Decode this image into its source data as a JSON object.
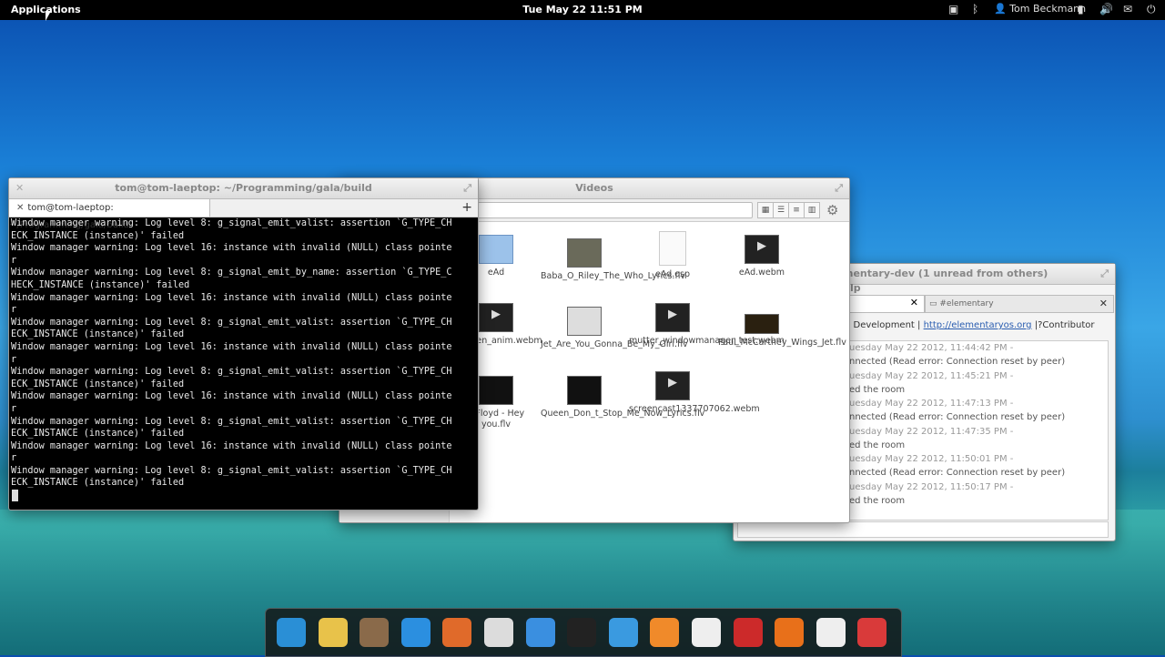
{
  "panel": {
    "applications": "Applications",
    "clock": "Tue May 22 11:51 PM",
    "user": "Tom Beckmann"
  },
  "terminal": {
    "title": "tom@tom-laeptop: ~/Programming/gala/build",
    "tab_label": "tom@tom-laeptop: ~/Programming/gala/build",
    "output": "Window manager warning: Log level 8: g_signal_emit_valist: assertion `G_TYPE_CH\nECK_INSTANCE (instance)' failed\nWindow manager warning: Log level 16: instance with invalid (NULL) class pointe\nr\nWindow manager warning: Log level 8: g_signal_emit_by_name: assertion `G_TYPE_C\nHECK_INSTANCE (instance)' failed\nWindow manager warning: Log level 16: instance with invalid (NULL) class pointe\nr\nWindow manager warning: Log level 8: g_signal_emit_valist: assertion `G_TYPE_CH\nECK_INSTANCE (instance)' failed\nWindow manager warning: Log level 16: instance with invalid (NULL) class pointe\nr\nWindow manager warning: Log level 8: g_signal_emit_valist: assertion `G_TYPE_CH\nECK_INSTANCE (instance)' failed\nWindow manager warning: Log level 16: instance with invalid (NULL) class pointe\nr\nWindow manager warning: Log level 8: g_signal_emit_valist: assertion `G_TYPE_CH\nECK_INSTANCE (instance)' failed\nWindow manager warning: Log level 16: instance with invalid (NULL) class pointe\nr\nWindow manager warning: Log level 8: g_signal_emit_valist: assertion `G_TYPE_CH\nECK_INSTANCE (instance)' failed"
  },
  "files": {
    "title": "Videos",
    "items": [
      {
        "name": "eAd",
        "kind": "folder"
      },
      {
        "name": "Baba_O_Riley_The_Who_Lyrics.flv",
        "kind": "video-frame"
      },
      {
        "name": "eAd.osp",
        "kind": "document"
      },
      {
        "name": "eAd.webm",
        "kind": "video"
      },
      {
        "name": "er_open_anim.webm",
        "kind": "video"
      },
      {
        "name": "Jet_Are_You_Gonna_Be_My_Girl.flv",
        "kind": "video-frame"
      },
      {
        "name": "mutter_windowmanager_test.webm",
        "kind": "video"
      },
      {
        "name": "Paul_McCartney_Wings_Jet.flv",
        "kind": "video-frame"
      },
      {
        "name": "k Floyd - Hey you.flv",
        "kind": "video-frame"
      },
      {
        "name": "Queen_Don_t_Stop_Me_Now_Lyrics.flv",
        "kind": "video-frame"
      },
      {
        "name": "screencast1337707062.webm",
        "kind": "video"
      }
    ]
  },
  "chat": {
    "title": "mentary-dev (1 unread from others)",
    "subtitle": "lp",
    "tab2_label": "#elementary",
    "topic_prefix": "p Development |",
    "topic_link": "http://elementaryos.org",
    "topic_suffix": "|?Contributor Meetin...",
    "log": [
      {
        "time": "uesday May 22 2012, 11:44:42 PM -",
        "text": "nnected (Read error: Connection reset by peer)"
      },
      {
        "time": "uesday May 22 2012, 11:45:21 PM -",
        "text": "ed the room"
      },
      {
        "time": "uesday May 22 2012, 11:47:13 PM -",
        "text": "nnected (Read error: Connection reset by peer)"
      },
      {
        "time": "uesday May 22 2012, 11:47:35 PM -",
        "text": "ed the room"
      },
      {
        "time": "uesday May 22 2012, 11:50:01 PM -",
        "text": "nnected (Read error: Connection reset by peer)"
      },
      {
        "time": "uesday May 22 2012, 11:50:17 PM -",
        "text": "ed the room"
      }
    ]
  },
  "dock": {
    "icons": [
      "midori-browser-icon",
      "mail-icon",
      "contacts-icon",
      "chat-icon",
      "photos-icon",
      "switchboard-icon",
      "downloads-icon",
      "terminal-icon",
      "postler-icon",
      "music-icon",
      "text-editor-icon",
      "presentation-icon",
      "firefox-icon",
      "clock-icon",
      "target-icon"
    ],
    "colors": [
      "#2a8fd6",
      "#e8c24a",
      "#8a6a4a",
      "#2b8fe0",
      "#e06a2a",
      "#dcdcdc",
      "#3a8fe0",
      "#222222",
      "#3a9ae0",
      "#f08a2a",
      "#eeeeee",
      "#cc2a2a",
      "#e8701a",
      "#eeeeee",
      "#d93a3a"
    ]
  }
}
